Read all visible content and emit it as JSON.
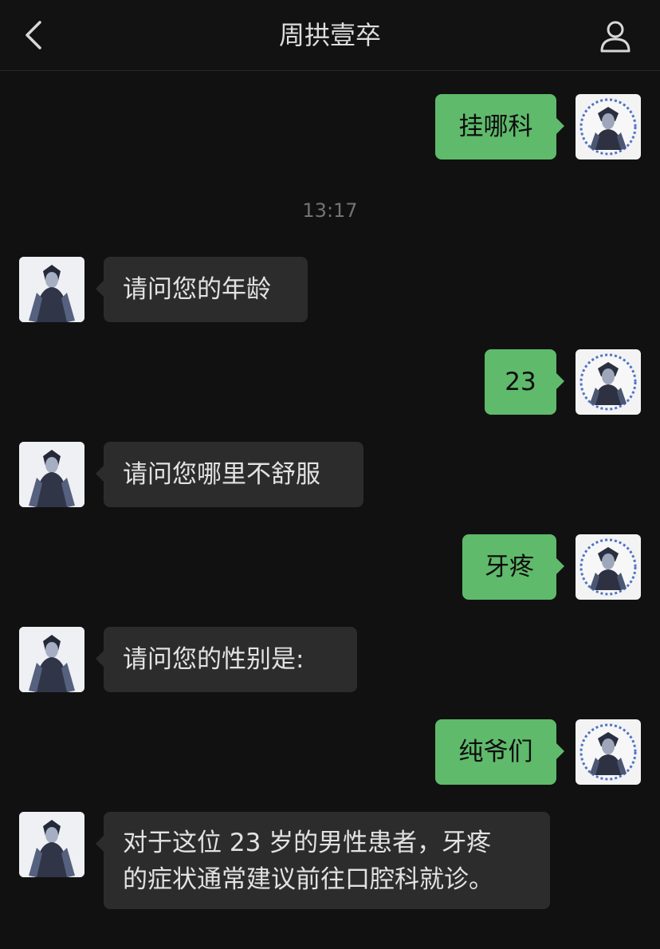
{
  "header": {
    "title": "周拱壹卒",
    "back_icon": "chevron-left-icon",
    "profile_icon": "person-icon"
  },
  "timestamp": "13:17",
  "messages": [
    {
      "sender": "self",
      "text": "挂哪科"
    },
    {
      "sender": "other",
      "text": "请问您的年龄"
    },
    {
      "sender": "self",
      "text": "23"
    },
    {
      "sender": "other",
      "text": "请问您哪里不舒服"
    },
    {
      "sender": "self",
      "text": "牙疼"
    },
    {
      "sender": "other",
      "text": "请问您的性别是:"
    },
    {
      "sender": "self",
      "text": "纯爷们"
    },
    {
      "sender": "other",
      "lines": [
        "对于这位 23 岁的男性患者，牙疼",
        "的症状通常建议前往口腔科就诊。"
      ]
    }
  ],
  "colors": {
    "background": "#111111",
    "self_bubble": "#5fba6b",
    "other_bubble": "#2c2c2c",
    "timestamp_text": "#737373"
  }
}
